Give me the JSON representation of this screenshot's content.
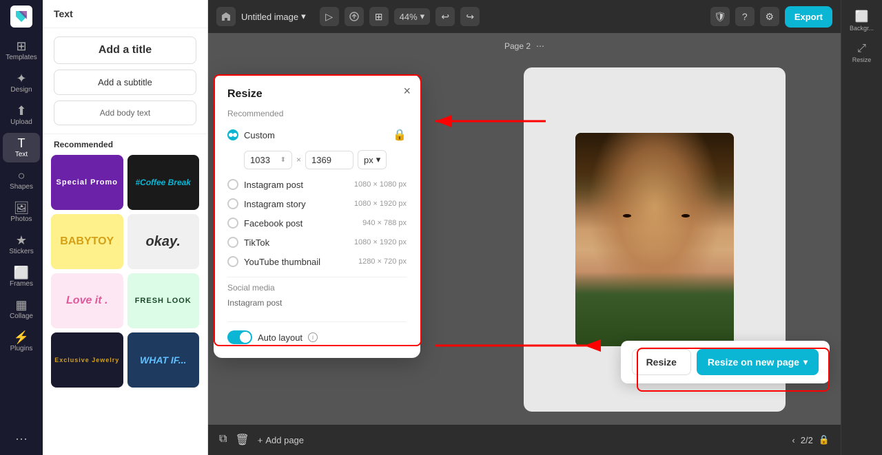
{
  "sidebar": {
    "items": [
      {
        "label": "Templates",
        "icon": "⊞"
      },
      {
        "label": "Design",
        "icon": "✦"
      },
      {
        "label": "Upload",
        "icon": "↑"
      },
      {
        "label": "Text",
        "icon": "T"
      },
      {
        "label": "Shapes",
        "icon": "○"
      },
      {
        "label": "Photos",
        "icon": "🖼"
      },
      {
        "label": "Stickers",
        "icon": "★"
      },
      {
        "label": "Frames",
        "icon": "⬜"
      },
      {
        "label": "Collage",
        "icon": "▦"
      },
      {
        "label": "Plugins",
        "icon": "⚡"
      }
    ]
  },
  "panel": {
    "header": "Text",
    "buttons": [
      {
        "label": "Add a title"
      },
      {
        "label": "Add a subtitle"
      },
      {
        "label": "Add body text"
      }
    ],
    "recommended_label": "Recommended",
    "templates": [
      {
        "label": "Special Promo",
        "style": "purple"
      },
      {
        "label": "#Coffee Break",
        "style": "dark"
      },
      {
        "label": "BABYTOY",
        "style": "yellow"
      },
      {
        "label": "okay.",
        "style": "italic"
      },
      {
        "label": "Love it .",
        "style": "pink"
      },
      {
        "label": "FRESH LOOK",
        "style": "dark-italic"
      },
      {
        "label": "Exclusive Jewelry",
        "style": "gold"
      },
      {
        "label": "WHAT IF...",
        "style": "blue"
      }
    ]
  },
  "topbar": {
    "title": "Untitled image",
    "zoom": "44%",
    "export_label": "Export",
    "page_indicator": "Page 2"
  },
  "modal": {
    "title": "Resize",
    "section_recommended": "Recommended",
    "options": [
      {
        "label": "Custom",
        "size": "",
        "selected": true
      },
      {
        "label": "Instagram post",
        "size": "1080 × 1080 px",
        "selected": false
      },
      {
        "label": "Instagram story",
        "size": "1080 × 1920 px",
        "selected": false
      },
      {
        "label": "Facebook post",
        "size": "940 × 788 px",
        "selected": false
      },
      {
        "label": "TikTok",
        "size": "1080 × 1920 px",
        "selected": false
      },
      {
        "label": "YouTube thumbnail",
        "size": "1280 × 720 px",
        "selected": false
      }
    ],
    "custom_width": "1033",
    "custom_height": "1369",
    "custom_unit": "px",
    "section_social": "Social media",
    "social_item": "Instagram post",
    "auto_layout_label": "Auto layout",
    "close_icon": "×",
    "resize_btn": "Resize",
    "resize_new_page_btn": "Resize on new page"
  },
  "bottom_bar": {
    "add_page": "Add page",
    "pagination": "2/2"
  },
  "right_panel": {
    "items": [
      {
        "label": "Backgr...",
        "icon": "⬜"
      },
      {
        "label": "Resize",
        "icon": "⤢"
      }
    ]
  }
}
